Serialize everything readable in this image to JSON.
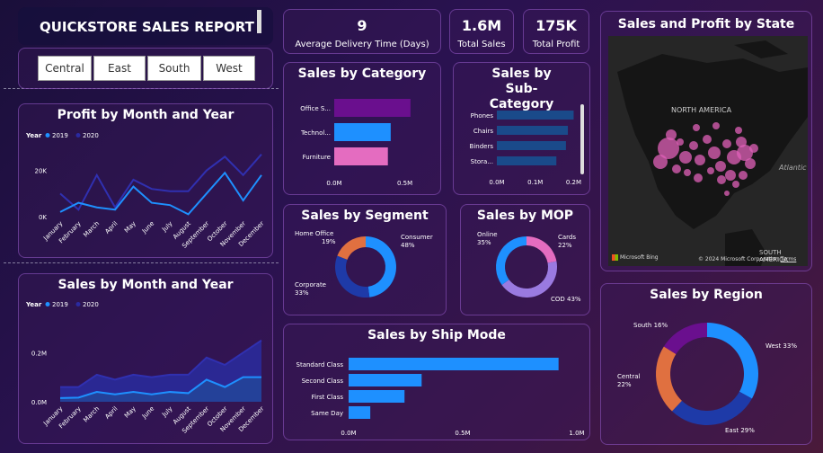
{
  "header": {
    "title": "QUICKSTORE SALES REPORT"
  },
  "filters": [
    "Central",
    "East",
    "South",
    "West"
  ],
  "kpis": [
    {
      "value": "9",
      "label": "Average Delivery Time (Days)"
    },
    {
      "value": "1.6M",
      "label": "Total Sales"
    },
    {
      "value": "175K",
      "label": "Total Profit"
    }
  ],
  "colors": {
    "y2019": "#1e90ff",
    "y2020": "#2a2aa0",
    "purple": "#6a0f8e",
    "blue": "#1e90ff",
    "pink": "#e46cc0",
    "orange": "#e07040",
    "navy": "#1e3aa8",
    "lavender": "#9a7ae0",
    "darkblue": "#1a4a8a"
  },
  "chart_data": [
    {
      "id": "profit_month",
      "type": "line",
      "title": "Profit by Month and Year",
      "legend_title": "Year",
      "categories": [
        "January",
        "February",
        "March",
        "April",
        "May",
        "June",
        "July",
        "August",
        "September",
        "October",
        "November",
        "December"
      ],
      "series": [
        {
          "name": "2019",
          "values": [
            2000,
            6000,
            4000,
            3000,
            13000,
            6000,
            5000,
            1000,
            10000,
            19000,
            7000,
            18000
          ]
        },
        {
          "name": "2020",
          "values": [
            10000,
            3000,
            18000,
            4000,
            16000,
            12000,
            11000,
            11000,
            20000,
            26000,
            18000,
            27000
          ]
        }
      ],
      "y_ticks": [
        "0K",
        "20K"
      ],
      "ylim": [
        0,
        30000
      ]
    },
    {
      "id": "sales_month",
      "type": "area",
      "title": "Sales by Month and Year",
      "legend_title": "Year",
      "categories": [
        "January",
        "February",
        "March",
        "April",
        "May",
        "June",
        "July",
        "August",
        "September",
        "October",
        "November",
        "December"
      ],
      "series": [
        {
          "name": "2019",
          "values": [
            0.015,
            0.017,
            0.04,
            0.03,
            0.04,
            0.03,
            0.04,
            0.035,
            0.09,
            0.06,
            0.1,
            0.1
          ]
        },
        {
          "name": "2020",
          "values": [
            0.06,
            0.06,
            0.11,
            0.09,
            0.11,
            0.1,
            0.11,
            0.11,
            0.18,
            0.15,
            0.2,
            0.25
          ]
        }
      ],
      "y_ticks": [
        "0.0M",
        "0.2M"
      ],
      "ylim": [
        0,
        0.3
      ]
    },
    {
      "id": "sales_category",
      "type": "bar",
      "title": "Sales by Category",
      "categories": [
        "Office S...",
        "Technol...",
        "Furniture"
      ],
      "values": [
        0.54,
        0.4,
        0.38
      ],
      "x_ticks": [
        "0.0M",
        "0.5M"
      ],
      "xlim": [
        0,
        0.7
      ]
    },
    {
      "id": "sales_subcategory",
      "type": "bar",
      "title": "Sales by Sub-Category",
      "categories": [
        "Phones",
        "Chairs",
        "Binders",
        "Stora..."
      ],
      "values": [
        0.2,
        0.185,
        0.18,
        0.155
      ],
      "x_ticks": [
        "0.0M",
        "0.1M",
        "0.2M"
      ],
      "xlim": [
        0,
        0.22
      ]
    },
    {
      "id": "sales_segment",
      "type": "pie",
      "title": "Sales by Segment",
      "labels": [
        "Consumer",
        "Corporate",
        "Home Office"
      ],
      "values": [
        48,
        33,
        19
      ]
    },
    {
      "id": "sales_mop",
      "type": "pie",
      "title": "Sales by MOP",
      "labels": [
        "Cards",
        "COD",
        "Online"
      ],
      "values": [
        22,
        43,
        35
      ]
    },
    {
      "id": "sales_shipmode",
      "type": "bar",
      "title": "Sales by Ship Mode",
      "categories": [
        "Standard Class",
        "Second Class",
        "First Class",
        "Same Day"
      ],
      "values": [
        0.92,
        0.32,
        0.245,
        0.095
      ],
      "x_ticks": [
        "0.0M",
        "0.5M",
        "1.0M"
      ],
      "xlim": [
        0,
        1.0
      ]
    },
    {
      "id": "sales_region",
      "type": "pie",
      "title": "Sales by Region",
      "labels": [
        "West",
        "East",
        "Central",
        "South"
      ],
      "values": [
        33,
        29,
        22,
        16
      ]
    }
  ],
  "map": {
    "title": "Sales and Profit by State",
    "label_continent": "NORTH AMERICA",
    "label_ocean": "Atlantic",
    "label_south": "SOUTH AMERICA",
    "attribution": "© 2024 Microsoft Corporation",
    "terms": "Terms",
    "brand": "Microsoft Bing"
  }
}
